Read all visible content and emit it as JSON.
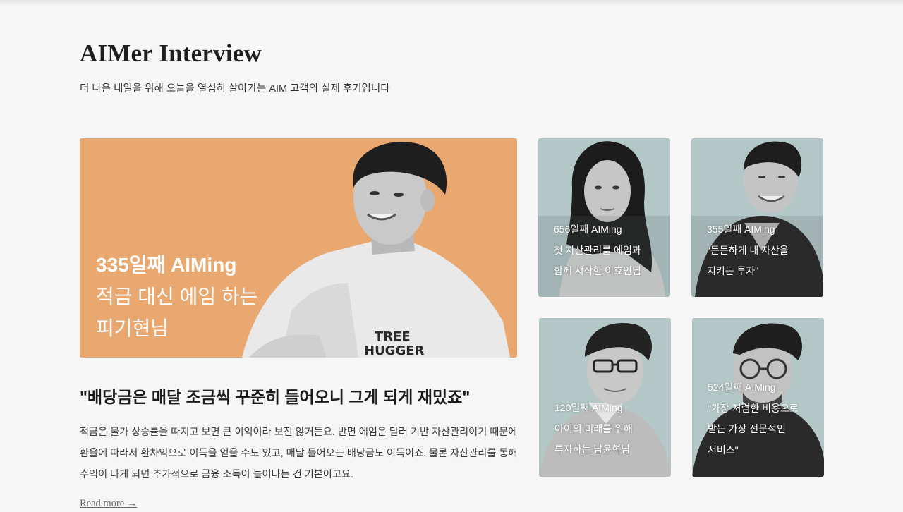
{
  "section": {
    "title": "AIMer Interview",
    "subtitle": "더 나은 내일을 위해 오늘을 열심히 살아가는 AIM 고객의 실제 후기입니다"
  },
  "featured": {
    "day_label": "335일째 AIMing",
    "title_line1": "적금 대신 에임 하는",
    "title_line2": "피기현님",
    "shirt_text_1": "TREE",
    "shirt_text_2": "HUGGER",
    "headline": "\"배당금은 매달 조금씩 꾸준히 들어오니 그게 되게 재밌죠\"",
    "excerpt": "적금은 물가 상승률을 따지고 보면 큰 이익이라 보진 않거든요. 반면 에임은 달러 기반 자산관리이기 때문에 환율에 따라서 환차익으로 이득을 얻을 수도 있고, 매달 들어오는 배당금도 이득이죠. 물론 자산관리를 통해 수익이 나게 되면 추가적으로 금융 소득이 늘어나는 건 기본이고요.",
    "read_more": "Read more →",
    "background_color": "#eaa871"
  },
  "cards": [
    {
      "day_label": "656일째 AIMing",
      "lines": [
        "첫 자산관리를 에임과",
        "함께 시작한 이효인님"
      ]
    },
    {
      "day_label": "355일째 AIMing",
      "lines": [
        "\"든든하게 내 자산을",
        "지키는 투자\""
      ]
    },
    {
      "day_label": "120일째 AIMing",
      "lines": [
        "아이의 미래를 위해",
        "투자하는 남윤혁님"
      ]
    },
    {
      "day_label": "524일째 AIMing",
      "lines": [
        "\"가장 저렴한 비용으로",
        "받는 가장 전문적인",
        "서비스\""
      ]
    }
  ],
  "colors": {
    "page_background": "#f6f6f6",
    "card_background": "#b3c7c6"
  }
}
